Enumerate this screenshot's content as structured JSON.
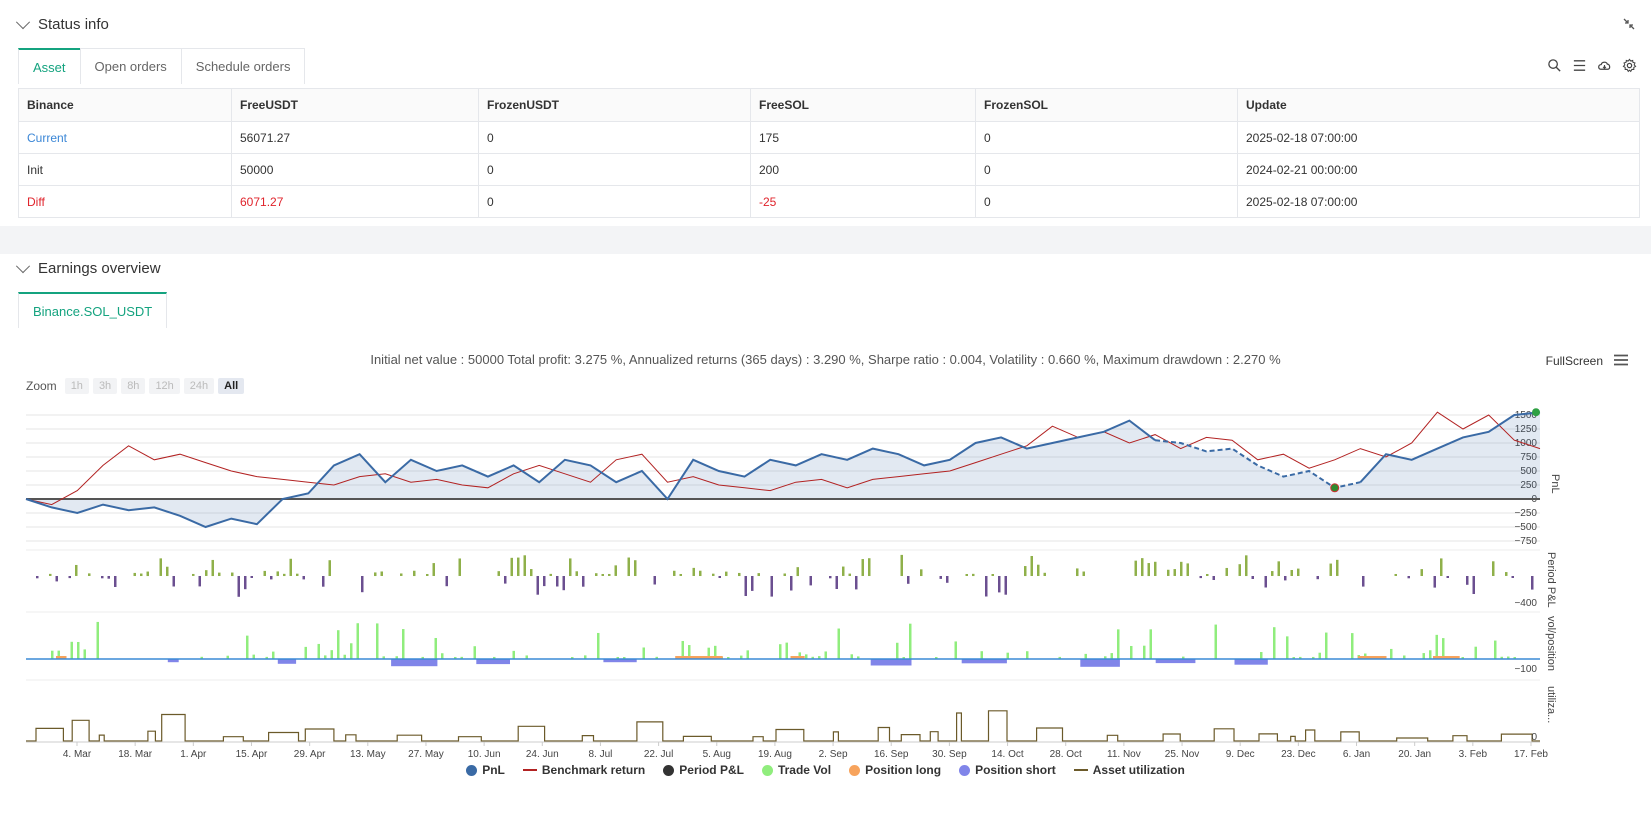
{
  "status": {
    "title": "Status info",
    "tabs": [
      {
        "label": "Asset",
        "active": true
      },
      {
        "label": "Open orders",
        "active": false
      },
      {
        "label": "Schedule orders",
        "active": false
      }
    ],
    "table": {
      "headers": [
        "Binance",
        "FreeUSDT",
        "FrozenUSDT",
        "FreeSOL",
        "FrozenSOL",
        "Update"
      ],
      "rows": [
        [
          "Current",
          "56071.27",
          "0",
          "175",
          "0",
          "2025-02-18 07:00:00"
        ],
        [
          "Init",
          "50000",
          "0",
          "200",
          "0",
          "2024-02-21 00:00:00"
        ],
        [
          "Diff",
          "6071.27",
          "0",
          "-25",
          "0",
          "2025-02-18 07:00:00"
        ]
      ]
    }
  },
  "earnings": {
    "title": "Earnings overview",
    "tab": "Binance.SOL_USDT",
    "summary": "Initial net value : 50000 Total profit: 3.275 %, Annualized returns (365 days) : 3.290 %, Sharpe ratio : 0.004, Volatility : 0.660 %, Maximum drawdown : 2.270 %",
    "fullscreen": "FullScreen",
    "zoom": {
      "label": "Zoom",
      "options": [
        "1h",
        "3h",
        "8h",
        "12h",
        "24h",
        "All"
      ],
      "active": "All"
    }
  },
  "chart_data": {
    "type": "line",
    "x_ticks": [
      "4. Mar",
      "18. Mar",
      "1. Apr",
      "15. Apr",
      "29. Apr",
      "13. May",
      "27. May",
      "10. Jun",
      "24. Jun",
      "8. Jul",
      "22. Jul",
      "5. Aug",
      "19. Aug",
      "2. Sep",
      "16. Sep",
      "30. Sep",
      "14. Oct",
      "28. Oct",
      "11. Nov",
      "25. Nov",
      "9. Dec",
      "23. Dec",
      "6. Jan",
      "20. Jan",
      "3. Feb",
      "17. Feb"
    ],
    "panes": [
      {
        "ylabel": "PnL",
        "y_ticks": [
          "1500",
          "1250",
          "1000",
          "750",
          "500",
          "250",
          "0",
          "−250",
          "−500",
          "−750"
        ]
      },
      {
        "ylabel": "Period P&L",
        "y_ticks": [
          "−400"
        ]
      },
      {
        "ylabel": "vol/position",
        "y_ticks": [
          "−100"
        ]
      },
      {
        "ylabel": "utiliza...",
        "y_ticks": [
          "0"
        ]
      }
    ],
    "series": [
      {
        "name": "PnL",
        "color": "#3a6aa5",
        "values": [
          0,
          -150,
          -250,
          -100,
          -200,
          -150,
          -300,
          -500,
          -350,
          -450,
          0,
          100,
          600,
          800,
          300,
          700,
          500,
          600,
          400,
          600,
          300,
          700,
          600,
          300,
          500,
          0,
          700,
          500,
          400,
          700,
          600,
          800,
          700,
          900,
          800,
          600,
          700,
          1000,
          1100,
          900,
          1000,
          1100,
          1200,
          1400,
          1050,
          1000,
          850,
          900,
          600,
          400,
          500,
          200,
          300,
          800,
          700,
          900,
          1100,
          1200,
          1500,
          1550
        ]
      },
      {
        "name": "Benchmark return",
        "color": "#b22222",
        "values": [
          0,
          -100,
          150,
          600,
          950,
          700,
          800,
          650,
          500,
          400,
          350,
          300,
          250,
          400,
          450,
          300,
          350,
          250,
          200,
          450,
          600,
          450,
          300,
          700,
          800,
          300,
          400,
          250,
          200,
          150,
          300,
          350,
          200,
          350,
          400,
          450,
          500,
          650,
          800,
          950,
          1300,
          1100,
          1200,
          1000,
          1150,
          900,
          1100,
          1050,
          700,
          800,
          550,
          700,
          900,
          750,
          1000,
          1550,
          1250,
          1500,
          1050,
          900
        ]
      },
      {
        "name": "Period P&L",
        "color": "#333333"
      },
      {
        "name": "Trade Vol",
        "color": "#90ed7d"
      },
      {
        "name": "Position long",
        "color": "#f7a35c"
      },
      {
        "name": "Position short",
        "color": "#8085e9"
      },
      {
        "name": "Asset utilization",
        "color": "#6b5a2a"
      }
    ]
  }
}
